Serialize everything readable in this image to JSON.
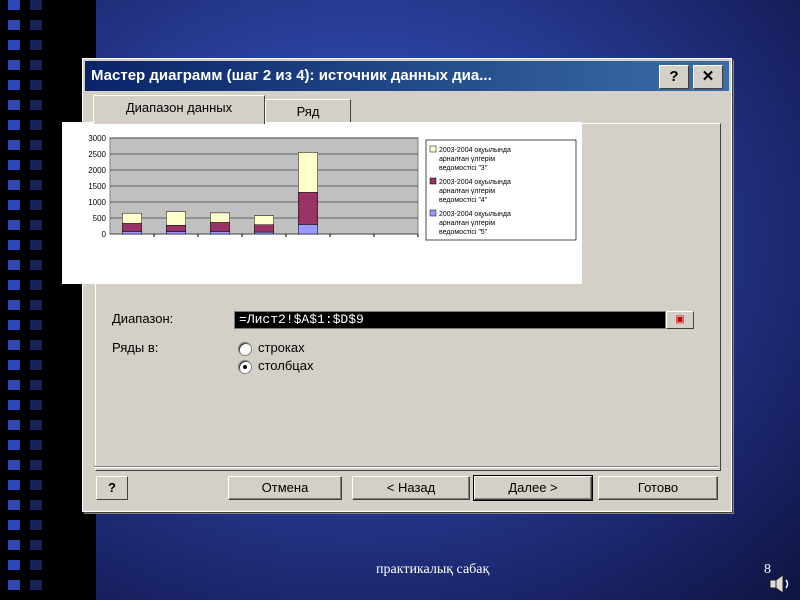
{
  "dialog": {
    "title": "Мастер диаграмм (шаг 2 из 4): источник данных диа...",
    "help_glyph": "?",
    "close_glyph": "✕"
  },
  "tabs": [
    {
      "label": "Диапазон данных"
    },
    {
      "label": "Ряд"
    }
  ],
  "chart_data": {
    "type": "bar",
    "stacked": true,
    "categories": [
      "",
      "",
      "",
      "",
      "",
      "",
      ""
    ],
    "series": [
      {
        "name": "2003-2004 оқуылында арналған үлгерім ведомостісі \"5\"",
        "color": "#9999ff",
        "values": [
          80,
          70,
          80,
          60,
          300,
          0,
          0
        ]
      },
      {
        "name": "2003-2004 оқуылында арналған үлгерім ведомостісі \"4\"",
        "color": "#993366",
        "values": [
          250,
          200,
          280,
          230,
          1000,
          0,
          0
        ]
      },
      {
        "name": "2003-2004 оқуылында арналған үлгерім ведомостісі \"3\"",
        "color": "#ffffcc",
        "values": [
          320,
          430,
          300,
          280,
          1250,
          0,
          0
        ]
      }
    ],
    "yticks": [
      0,
      500,
      1000,
      1500,
      2000,
      2500,
      3000
    ],
    "ylim": [
      0,
      3000
    ],
    "grid": true,
    "legend": "right"
  },
  "form": {
    "range_label": "Диапазон:",
    "range_value": "=Лист2!$A$1:$D$9",
    "series_in_label": "Ряды в:",
    "opt_rows": "строках",
    "opt_cols": "столбцах",
    "selected": "columns"
  },
  "buttons": {
    "help": "?",
    "cancel": "Отмена",
    "back": "< Назад",
    "next": "Далее >",
    "finish": "Готово"
  },
  "footer": {
    "text": "практикалық сабақ",
    "page": "8"
  }
}
